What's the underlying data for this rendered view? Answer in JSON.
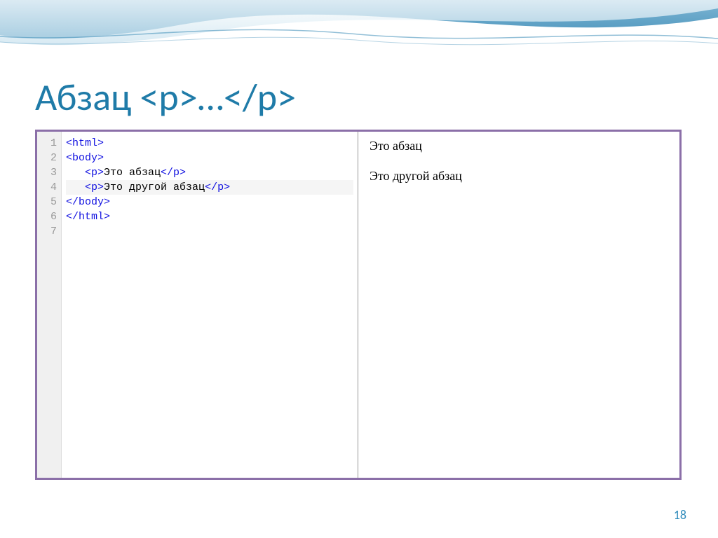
{
  "title": "Абзац  <p>…</p>",
  "code": {
    "lineNumbers": [
      "1",
      "2",
      "3",
      "4",
      "5",
      "6",
      "7"
    ],
    "lines": [
      {
        "parts": [
          {
            "cls": "tag",
            "t": "<html>"
          }
        ],
        "hl": false
      },
      {
        "parts": [
          {
            "cls": "tag",
            "t": "<body>"
          }
        ],
        "hl": false
      },
      {
        "parts": [
          {
            "cls": "txt",
            "t": "   "
          },
          {
            "cls": "tag",
            "t": "<p>"
          },
          {
            "cls": "txt",
            "t": "Это абзац"
          },
          {
            "cls": "tag",
            "t": "</p>"
          }
        ],
        "hl": false
      },
      {
        "parts": [
          {
            "cls": "txt",
            "t": "   "
          },
          {
            "cls": "tag",
            "t": "<p>"
          },
          {
            "cls": "txt",
            "t": "Это другой абзац"
          },
          {
            "cls": "tag",
            "t": "</p>"
          }
        ],
        "hl": true
      },
      {
        "parts": [
          {
            "cls": "tag",
            "t": "</body>"
          }
        ],
        "hl": false
      },
      {
        "parts": [
          {
            "cls": "tag",
            "t": "</html>"
          }
        ],
        "hl": false
      },
      {
        "parts": [
          {
            "cls": "txt",
            "t": ""
          }
        ],
        "hl": false
      }
    ]
  },
  "preview": {
    "p1": "Это абзац",
    "p2": "Это другой абзац"
  },
  "pageNumber": "18"
}
